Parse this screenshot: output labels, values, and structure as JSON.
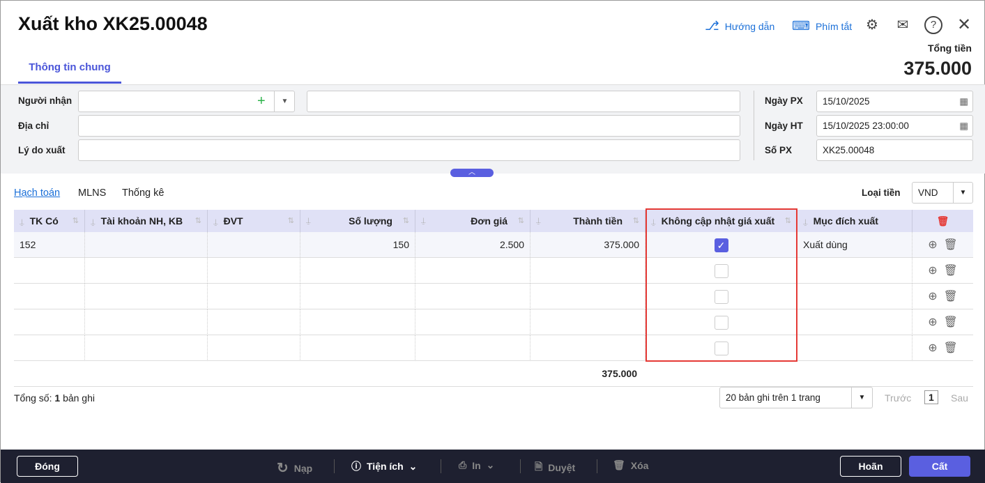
{
  "header": {
    "title": "Xuất kho XK25.00048",
    "guide": "Hướng dẫn",
    "shortcuts": "Phím tắt",
    "total_label": "Tổng tiền",
    "total_value": "375.000"
  },
  "tabs": [
    {
      "label": "Thông tin chung"
    }
  ],
  "form": {
    "recipient_label": "Người nhận",
    "recipient_value": "",
    "recipient_name": "",
    "address_label": "Địa chỉ",
    "address_value": "",
    "reason_label": "Lý do xuất",
    "reason_value": "",
    "date_px_label": "Ngày PX",
    "date_px": "15/10/2025",
    "date_ht_label": "Ngày HT",
    "date_ht": "15/10/2025 23:00:00",
    "so_px_label": "Số PX",
    "so_px": "XK25.00048"
  },
  "subtabs": [
    "Hạch toán",
    "MLNS",
    "Thống kê"
  ],
  "currency": {
    "label": "Loại tiền",
    "value": "VND"
  },
  "table": {
    "columns": [
      "TK Có",
      "Tài khoản NH, KB",
      "ĐVT",
      "Số lượng",
      "Đơn giá",
      "Thành tiền",
      "Không cập nhật giá xuất",
      "Mục đích xuất"
    ],
    "rows": [
      {
        "tk_co": "152",
        "tk_nh": "",
        "dvt": "",
        "so_luong": "150",
        "don_gia": "2.500",
        "thanh_tien": "375.000",
        "khong_cap_nhat": true,
        "muc_dich": "Xuất dùng"
      },
      {
        "tk_co": "",
        "tk_nh": "",
        "dvt": "",
        "so_luong": "",
        "don_gia": "",
        "thanh_tien": "",
        "khong_cap_nhat": false,
        "muc_dich": ""
      },
      {
        "tk_co": "",
        "tk_nh": "",
        "dvt": "",
        "so_luong": "",
        "don_gia": "",
        "thanh_tien": "",
        "khong_cap_nhat": false,
        "muc_dich": ""
      },
      {
        "tk_co": "",
        "tk_nh": "",
        "dvt": "",
        "so_luong": "",
        "don_gia": "",
        "thanh_tien": "",
        "khong_cap_nhat": false,
        "muc_dich": ""
      },
      {
        "tk_co": "",
        "tk_nh": "",
        "dvt": "",
        "so_luong": "",
        "don_gia": "",
        "thanh_tien": "",
        "khong_cap_nhat": false,
        "muc_dich": ""
      }
    ],
    "total": "375.000"
  },
  "pagination": {
    "count_prefix": "Tổng số:",
    "count": "1",
    "count_suffix": "bản ghi",
    "page_size": "20 bản ghi trên 1 trang",
    "prev": "Trước",
    "page": "1",
    "next": "Sau"
  },
  "footer": {
    "close": "Đóng",
    "reload": "Nạp",
    "utilities": "Tiện ích",
    "print": "In",
    "approve": "Duyệt",
    "delete": "Xóa",
    "postpone": "Hoãn",
    "save": "Cất"
  }
}
